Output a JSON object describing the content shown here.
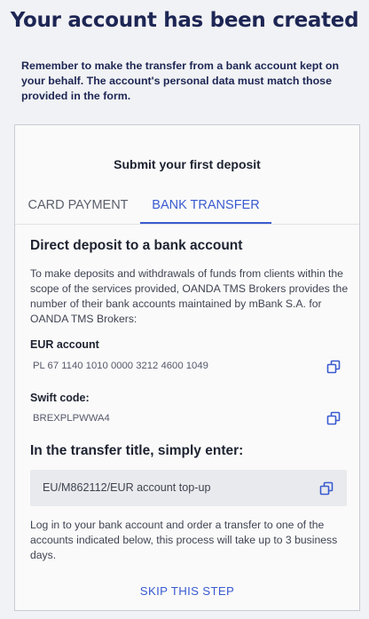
{
  "page": {
    "title": "Your account has been created",
    "notice": "Remember to make the transfer from a bank account kept on your behalf. The account's personal data must match those provided in the form."
  },
  "card": {
    "heading": "Submit your first deposit",
    "tabs": [
      {
        "label": "CARD PAYMENT",
        "active": false
      },
      {
        "label": "BANK TRANSFER",
        "active": true
      }
    ],
    "section_title": "Direct deposit to a bank account",
    "description": "To make deposits and withdrawals of funds from clients within the scope of the services provided, OANDA TMS Brokers provides the number of their bank accounts maintained by mBank S.A. for OANDA TMS Brokers:",
    "eur_account_label": "EUR account",
    "eur_account_value": "PL 67 1140 1010 0000 3212 4600 1049",
    "swift_label": "Swift code:",
    "swift_value": "BREXPLPWWA4",
    "transfer_title_label": "In the transfer title, simply enter:",
    "transfer_title_value": "EU/M862112/EUR account top-up",
    "info": "Log in to your bank account and order a transfer to one of the accounts indicated below, this process will take up to 3 business days.",
    "skip_label": "SKIP THIS STEP"
  },
  "colors": {
    "accent": "#3a5bd0",
    "heading": "#1d2654",
    "background": "#f1f2f5"
  },
  "icons": [
    "copy-icon"
  ]
}
